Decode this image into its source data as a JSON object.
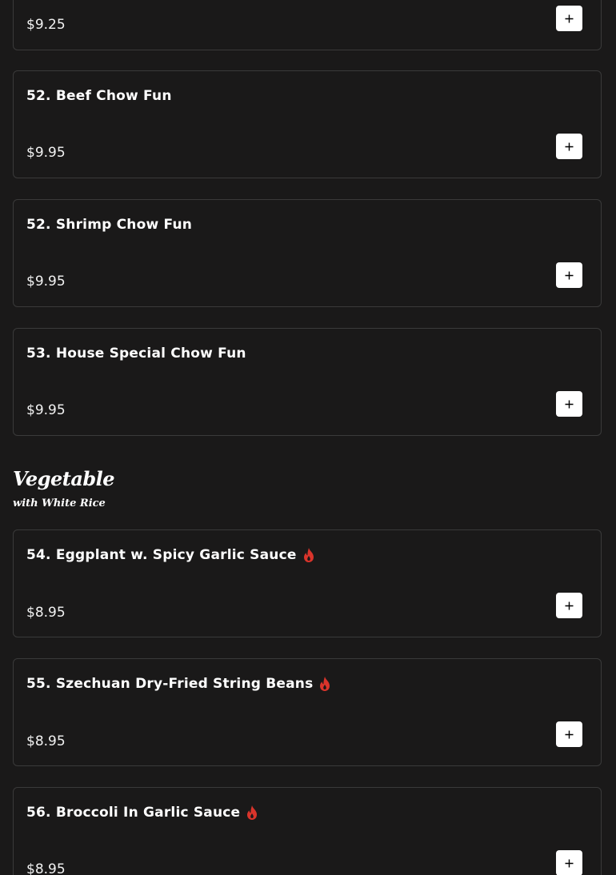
{
  "items_top": [
    {
      "title": "",
      "price": "$9.25",
      "spicy": false
    },
    {
      "title": "52. Beef Chow Fun",
      "price": "$9.95",
      "spicy": false
    },
    {
      "title": "52. Shrimp Chow Fun",
      "price": "$9.95",
      "spicy": false
    },
    {
      "title": "53. House Special Chow Fun",
      "price": "$9.95",
      "spicy": false
    }
  ],
  "section": {
    "title": "Vegetable",
    "subtitle": "with White Rice"
  },
  "items_vegetable": [
    {
      "title": "54. Eggplant w. Spicy Garlic Sauce",
      "price": "$8.95",
      "spicy": true
    },
    {
      "title": "55. Szechuan Dry-Fried String Beans",
      "price": "$8.95",
      "spicy": true
    },
    {
      "title": "56. Broccoli In Garlic Sauce",
      "price": "$8.95",
      "spicy": true
    }
  ],
  "colors": {
    "background": "#1a1919",
    "card_border": "#3a3a3a",
    "spicy_icon": "#d9342b",
    "button": "#ffffff"
  },
  "icons": {
    "spicy": "flame-icon",
    "add": "plus-icon"
  }
}
